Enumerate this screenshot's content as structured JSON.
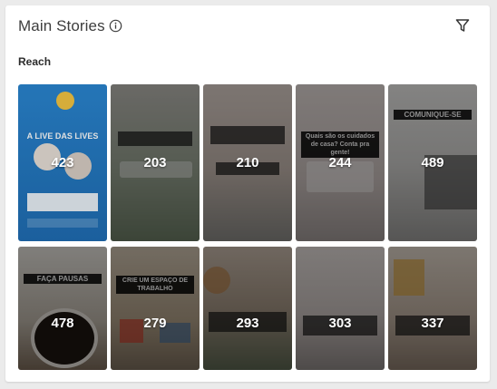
{
  "header": {
    "title": "Main Stories",
    "info_icon": "info-icon",
    "filter_icon": "filter-icon"
  },
  "metric_label": "Reach",
  "stories": [
    {
      "reach": "423",
      "caption": "A LIVE DAS LIVES",
      "colors": [
        "#2a7fc9",
        "#1f6db3"
      ]
    },
    {
      "reach": "203",
      "caption": "",
      "colors": [
        "#6c6a63",
        "#4d5a4a"
      ]
    },
    {
      "reach": "210",
      "caption": "",
      "colors": [
        "#8b817b",
        "#5d5652"
      ]
    },
    {
      "reach": "244",
      "caption": "Quais são os cuidados de casa? Conta pra gente!",
      "colors": [
        "#8f8683",
        "#6b6463"
      ]
    },
    {
      "reach": "489",
      "caption": "COMUNIQUE-SE",
      "colors": [
        "#7d7c7a",
        "#5b5a59"
      ]
    },
    {
      "reach": "478",
      "caption": "FAÇA PAUSAS",
      "colors": [
        "#c0b7aa",
        "#7a6655"
      ]
    },
    {
      "reach": "279",
      "caption": "CRIE UM ESPAÇO DE TRABALHO",
      "colors": [
        "#a89880",
        "#6e6456"
      ]
    },
    {
      "reach": "293",
      "caption": "",
      "colors": [
        "#8a7d70",
        "#4a4f40"
      ]
    },
    {
      "reach": "303",
      "caption": "",
      "colors": [
        "#8a827f",
        "#5f5958"
      ]
    },
    {
      "reach": "337",
      "caption": "",
      "colors": [
        "#9b8f84",
        "#6a5f56"
      ]
    }
  ]
}
